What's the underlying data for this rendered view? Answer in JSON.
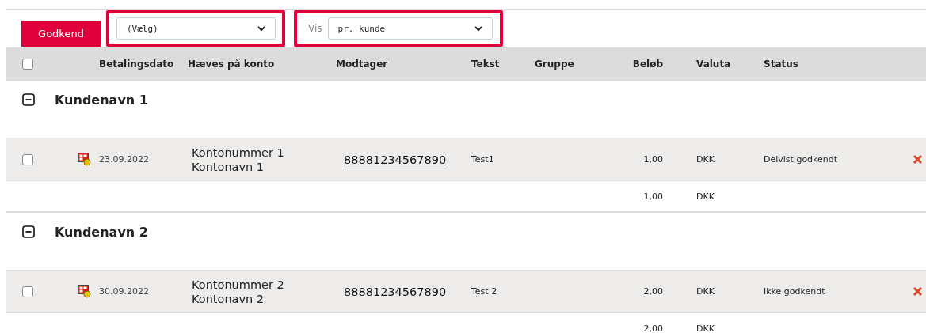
{
  "toolbar": {
    "approve_button": "Godkend",
    "action_select": {
      "value": "(Vælg)"
    },
    "view_label": "Vis",
    "view_select": {
      "value": "pr. kunde"
    }
  },
  "table": {
    "select_all_checked": false,
    "columns": [
      "Betalingsdato",
      "Hæves på konto",
      "Modtager",
      "Tekst",
      "Gruppe",
      "Beløb",
      "Valuta",
      "Status"
    ],
    "groups": [
      {
        "name": "Kundenavn 1",
        "expanded": true,
        "rows": [
          {
            "checked": false,
            "date": "23.09.2022",
            "account_number": "Kontonummer 1",
            "account_name": "Kontonavn 1",
            "recipient": "88881234567890",
            "text": "Test1",
            "amount": "1,00",
            "currency": "DKK",
            "status": "Delvist godkendt"
          }
        ],
        "total": {
          "amount": "1,00",
          "currency": "DKK"
        }
      },
      {
        "name": "Kundenavn 2",
        "expanded": true,
        "rows": [
          {
            "checked": false,
            "date": "30.09.2022",
            "account_number": "Kontonummer 2",
            "account_name": "Kontonavn 2",
            "recipient": "88881234567890",
            "text": "Test 2",
            "amount": "2,00",
            "currency": "DKK",
            "status": "Ikke godkendt"
          }
        ],
        "total": {
          "amount": "2,00",
          "currency": "DKK"
        }
      }
    ]
  }
}
